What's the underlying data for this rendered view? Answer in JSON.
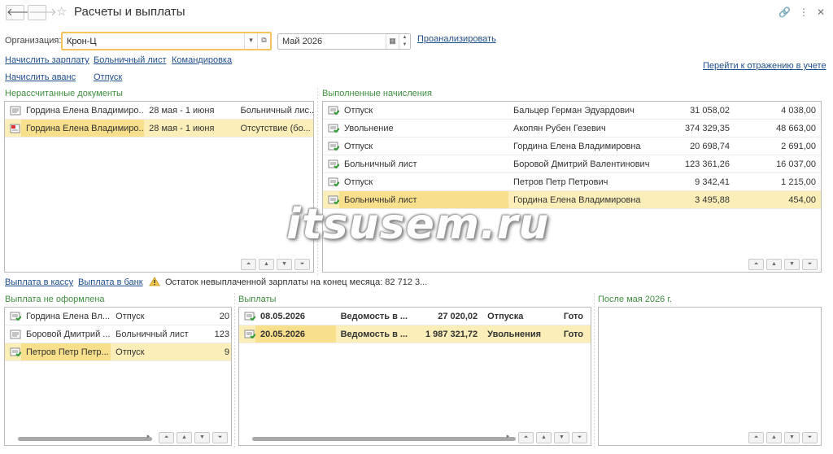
{
  "window": {
    "title": "Расчеты и выплаты",
    "back_icon": "arrow-left-icon",
    "forward_icon": "arrow-right-icon",
    "favorite_icon": "star-icon",
    "top_icons": [
      "link-icon",
      "more-icon",
      "close-icon"
    ]
  },
  "filters": {
    "org_label": "Организация:",
    "org_value": "Крон-Ц",
    "period_value": "Май 2026",
    "analyze_link": "Проанализировать"
  },
  "actions": {
    "accrue_salary": "Начислить зарплату",
    "sick_leave": "Больничный лист",
    "business_trip": "Командировка",
    "accrue_advance": "Начислить аванс",
    "vacation": "Отпуск",
    "go_to_accounting": "Перейти к отражению в учете"
  },
  "unprocessed": {
    "title": "Нерассчитанные документы",
    "rows": [
      {
        "name": "Гордина Елена Владимиро...",
        "period": "28 мая - 1 июня",
        "doc": "Больничный лис...",
        "icon": "document-icon"
      },
      {
        "name": "Гордина Елена Владимиро...",
        "period": "28 мая - 1 июня",
        "doc": "Отсутствие (бо...",
        "icon": "document-red-icon"
      }
    ]
  },
  "accruals": {
    "title": "Выполненные начисления",
    "rows": [
      {
        "doc": "Отпуск",
        "employee": "Бальцер Герман Эдуардович",
        "amount": "31 058,02",
        "tax": "4 038,00"
      },
      {
        "doc": "Увольнение",
        "employee": "Акопян Рубен Гезевич",
        "amount": "374 329,35",
        "tax": "48 663,00"
      },
      {
        "doc": "Отпуск",
        "employee": "Гордина Елена Владимировна",
        "amount": "20 698,74",
        "tax": "2 691,00"
      },
      {
        "doc": "Больничный лист",
        "employee": "Боровой Дмитрий Валентинович",
        "amount": "123 361,26",
        "tax": "16 037,00"
      },
      {
        "doc": "Отпуск",
        "employee": "Петров Петр Петрович",
        "amount": "9 342,41",
        "tax": "1 215,00"
      },
      {
        "doc": "Больничный лист",
        "employee": "Гордина Елена Владимировна",
        "amount": "3 495,88",
        "tax": "454,00"
      }
    ]
  },
  "payment_links": {
    "cash": "Выплата в кассу",
    "bank": "Выплата в банк",
    "balance_text": "Остаток невыплаченной зарплаты на конец месяца: 82 712 3..."
  },
  "not_issued": {
    "title": "Выплата не оформлена",
    "rows": [
      {
        "name": "Гордина Елена Вл...",
        "doc": "Отпуск",
        "amount": "20"
      },
      {
        "name": "Боровой Дмитрий ...",
        "doc": "Больничный лист",
        "amount": "123"
      },
      {
        "name": "Петров Петр Петр...",
        "doc": "Отпуск",
        "amount": "9"
      }
    ]
  },
  "payments": {
    "title": "Выплаты",
    "rows": [
      {
        "date": "08.05.2026",
        "doc": "Ведомость в ...",
        "amount": "27 020,02",
        "kind": "Отпуска",
        "status": "Гото"
      },
      {
        "date": "20.05.2026",
        "doc": "Ведомость в ...",
        "amount": "1 987 321,72",
        "kind": "Увольнения",
        "status": "Гото"
      }
    ]
  },
  "after": {
    "title": "После мая 2026 г."
  },
  "watermark": "itsusem.ru"
}
